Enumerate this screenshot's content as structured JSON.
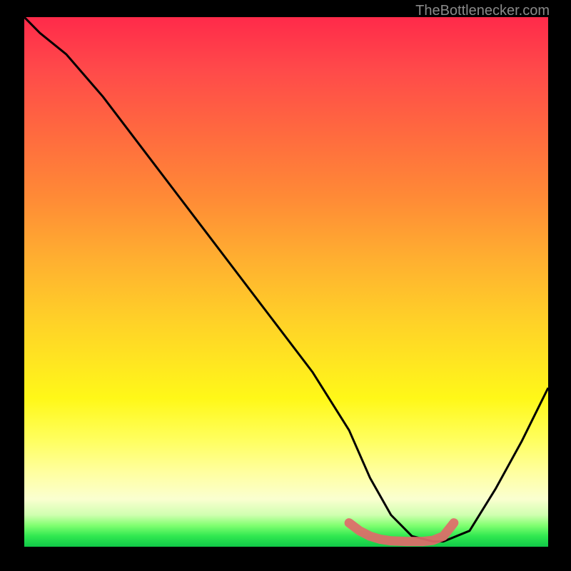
{
  "watermark": "TheBottlenecker.com",
  "chart_data": {
    "type": "line",
    "title": "",
    "xlabel": "",
    "ylabel": "",
    "xlim": [
      0,
      100
    ],
    "ylim": [
      0,
      100
    ],
    "series": [
      {
        "name": "curve",
        "x": [
          0,
          3,
          8,
          15,
          25,
          35,
          45,
          55,
          62,
          66,
          70,
          74,
          78,
          80,
          85,
          90,
          95,
          100
        ],
        "values": [
          100,
          97,
          93,
          85,
          72,
          59,
          46,
          33,
          22,
          13,
          6,
          2,
          1,
          1,
          3,
          11,
          20,
          30
        ]
      },
      {
        "name": "highlight-band",
        "x": [
          62,
          64,
          66,
          68,
          70,
          73,
          76,
          78,
          80,
          82
        ],
        "values": [
          4.5,
          3,
          2,
          1.4,
          1.1,
          1,
          1,
          1.2,
          2,
          4.5
        ]
      }
    ],
    "colors": {
      "curve": "#000000",
      "highlight": "#e06a6a",
      "background_top": "#ff2a4a",
      "background_bottom": "#10c848"
    },
    "grid": false,
    "legend": false
  }
}
